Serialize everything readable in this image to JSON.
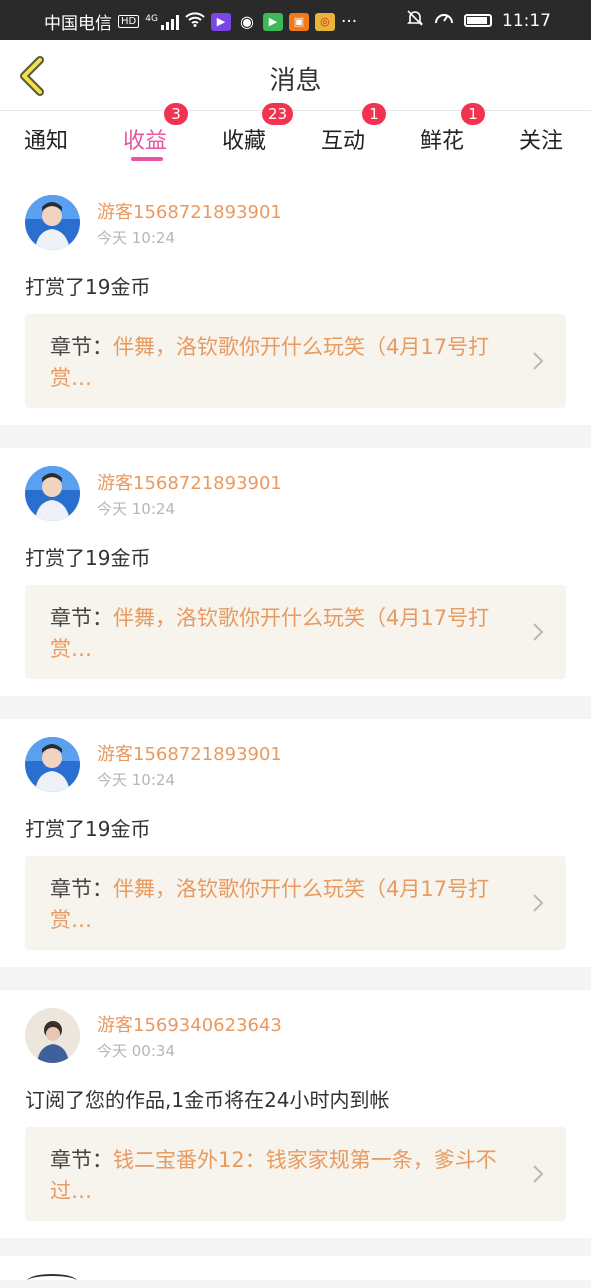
{
  "statusbar": {
    "carrier": "中国电信",
    "hd": "HD",
    "net": "4G",
    "more": "···",
    "time": "11:17"
  },
  "header": {
    "title": "消息"
  },
  "tabs": [
    {
      "label": "通知",
      "badge": ""
    },
    {
      "label": "收益",
      "badge": "3",
      "active": true
    },
    {
      "label": "收藏",
      "badge": "23"
    },
    {
      "label": "互动",
      "badge": "1"
    },
    {
      "label": "鲜花",
      "badge": "1"
    },
    {
      "label": "关注",
      "badge": ""
    }
  ],
  "messages": [
    {
      "user": "游客1568721893901",
      "time": "今天 10:24",
      "action": "打赏了19金币",
      "chapter_label": "章节：",
      "chapter_title": "伴舞，洛钦歌你开什么玩笑（4月17号打赏…"
    },
    {
      "user": "游客1568721893901",
      "time": "今天 10:24",
      "action": "打赏了19金币",
      "chapter_label": "章节：",
      "chapter_title": "伴舞，洛钦歌你开什么玩笑（4月17号打赏…"
    },
    {
      "user": "游客1568721893901",
      "time": "今天 10:24",
      "action": "打赏了19金币",
      "chapter_label": "章节：",
      "chapter_title": "伴舞，洛钦歌你开什么玩笑（4月17号打赏…"
    },
    {
      "user": "游客1569340623643",
      "time": "今天 00:34",
      "action": "订阅了您的作品,1金币将在24小时内到帐",
      "chapter_label": "章节：",
      "chapter_title": "钱二宝番外12：钱家家规第一条，爹斗不过…"
    }
  ],
  "colors": {
    "accent": "#e9559f",
    "badge": "#f2334f",
    "username": "#e89a60",
    "chapter_bg": "#f6f4ec"
  },
  "icons": [
    "back-chevron-icon",
    "wifi-icon",
    "signal-icon",
    "battery-icon",
    "mute-icon",
    "chevron-right-icon"
  ]
}
